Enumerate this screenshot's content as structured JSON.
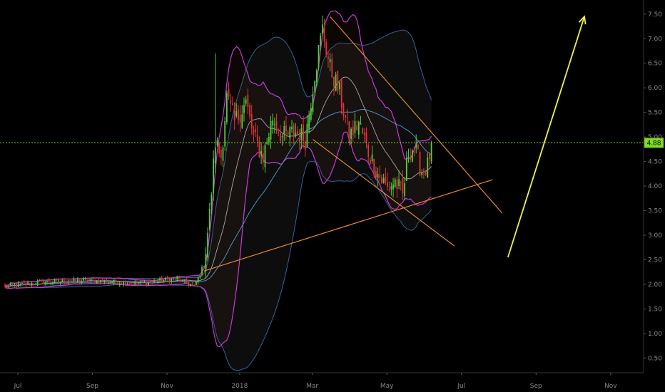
{
  "chart_data": {
    "type": "candlestick",
    "y_axis": {
      "position": "right",
      "ylim": [
        0.2,
        7.7
      ],
      "ticks": [
        "7.50",
        "7.00",
        "6.50",
        "6.00",
        "5.50",
        "5.00",
        "4.50",
        "4.00",
        "3.50",
        "3.00",
        "2.50",
        "2.00",
        "1.50",
        "1.00",
        "0.50"
      ]
    },
    "x_axis": {
      "ticks": [
        {
          "label": "Jul",
          "i": 0
        },
        {
          "label": "Sep",
          "i": 39
        },
        {
          "label": "Nov",
          "i": 78
        },
        {
          "label": "2018",
          "i": 116
        },
        {
          "label": "Mar",
          "i": 154
        },
        {
          "label": "May",
          "i": 193
        },
        {
          "label": "Jul",
          "i": 232
        },
        {
          "label": "Sep",
          "i": 271
        },
        {
          "label": "Nov",
          "i": 310
        }
      ]
    },
    "last_price": {
      "label": "4.88",
      "value": 4.88,
      "color": "#7ddc1f"
    },
    "candle_colors": {
      "up": "#4fd13a",
      "down": "#e0323a"
    },
    "indicator_colors": {
      "bollinger_inner": "#c63bd6",
      "bollinger_outer": "#3a5f95",
      "sma_short": "#bdbdbd",
      "sma_long": "#5aa6d8"
    },
    "anchors": [
      {
        "i": 0,
        "v": 1.95
      },
      {
        "i": 20,
        "v": 2.05
      },
      {
        "i": 45,
        "v": 2.08
      },
      {
        "i": 70,
        "v": 2.02
      },
      {
        "i": 90,
        "v": 2.12
      },
      {
        "i": 99,
        "v": 1.95
      },
      {
        "i": 104,
        "v": 2.4
      },
      {
        "i": 107,
        "v": 3.4
      },
      {
        "i": 110,
        "v": 4.9
      },
      {
        "i": 113,
        "v": 4.6
      },
      {
        "i": 116,
        "v": 5.8
      },
      {
        "i": 120,
        "v": 5.3
      },
      {
        "i": 126,
        "v": 5.7
      },
      {
        "i": 130,
        "v": 5.0
      },
      {
        "i": 135,
        "v": 4.6
      },
      {
        "i": 140,
        "v": 5.4
      },
      {
        "i": 145,
        "v": 5.0
      },
      {
        "i": 152,
        "v": 5.1
      },
      {
        "i": 157,
        "v": 4.95
      },
      {
        "i": 162,
        "v": 6.3
      },
      {
        "i": 166,
        "v": 7.2
      },
      {
        "i": 170,
        "v": 6.4
      },
      {
        "i": 175,
        "v": 5.9
      },
      {
        "i": 180,
        "v": 5.0
      },
      {
        "i": 185,
        "v": 5.3
      },
      {
        "i": 190,
        "v": 4.7
      },
      {
        "i": 195,
        "v": 4.25
      },
      {
        "i": 200,
        "v": 3.95
      },
      {
        "i": 204,
        "v": 4.1
      },
      {
        "i": 208,
        "v": 3.8
      },
      {
        "i": 211,
        "v": 4.7
      },
      {
        "i": 214,
        "v": 4.8
      },
      {
        "i": 218,
        "v": 4.3
      },
      {
        "i": 221,
        "v": 4.4
      },
      {
        "i": 223,
        "v": 4.88
      }
    ],
    "annotations": {
      "orange_lines": [
        {
          "x1": 170,
          "y1": 7.45,
          "x2": 260,
          "y2": 3.45
        },
        {
          "x1": 161,
          "y1": 4.95,
          "x2": 235,
          "y2": 2.78
        },
        {
          "x1": 104,
          "y1": 2.27,
          "x2": 255,
          "y2": 4.13
        }
      ],
      "orange_color": "#e5892a",
      "yellow_arrow": {
        "x1": 263,
        "y1": 2.55,
        "x2": 303,
        "y2": 7.45,
        "color": "#f2f24a"
      }
    }
  }
}
